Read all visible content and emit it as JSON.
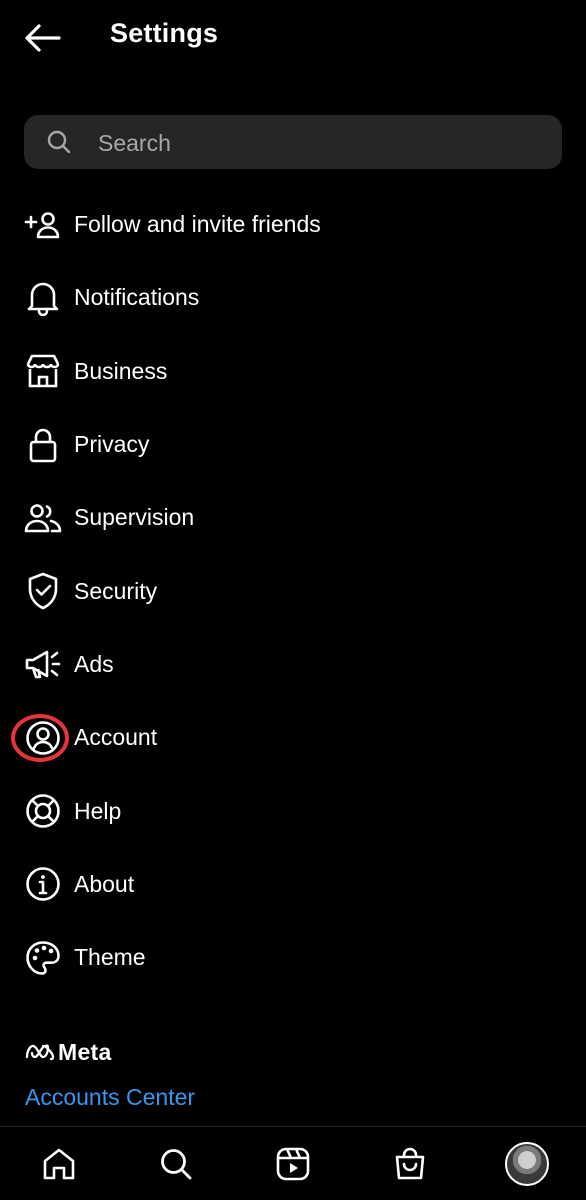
{
  "header": {
    "title": "Settings"
  },
  "search": {
    "placeholder": "Search"
  },
  "menu": {
    "items": [
      {
        "label": "Follow and invite friends",
        "icon": "add-person-icon"
      },
      {
        "label": "Notifications",
        "icon": "bell-icon"
      },
      {
        "label": "Business",
        "icon": "storefront-icon"
      },
      {
        "label": "Privacy",
        "icon": "lock-icon"
      },
      {
        "label": "Supervision",
        "icon": "people-icon"
      },
      {
        "label": "Security",
        "icon": "shield-icon"
      },
      {
        "label": "Ads",
        "icon": "megaphone-icon"
      },
      {
        "label": "Account",
        "icon": "user-circle-icon",
        "highlighted": true
      },
      {
        "label": "Help",
        "icon": "lifebuoy-icon"
      },
      {
        "label": "About",
        "icon": "info-icon"
      },
      {
        "label": "Theme",
        "icon": "palette-icon"
      }
    ]
  },
  "footer": {
    "brand": "Meta",
    "accounts_center": "Accounts Center",
    "link_color": "#3797f0"
  },
  "tabbar": {
    "tabs": [
      "home-icon",
      "search-icon",
      "reels-icon",
      "shop-icon",
      "profile-avatar"
    ]
  },
  "colors": {
    "background": "#000000",
    "highlight": "#e8323c",
    "search_bg": "#262626"
  }
}
